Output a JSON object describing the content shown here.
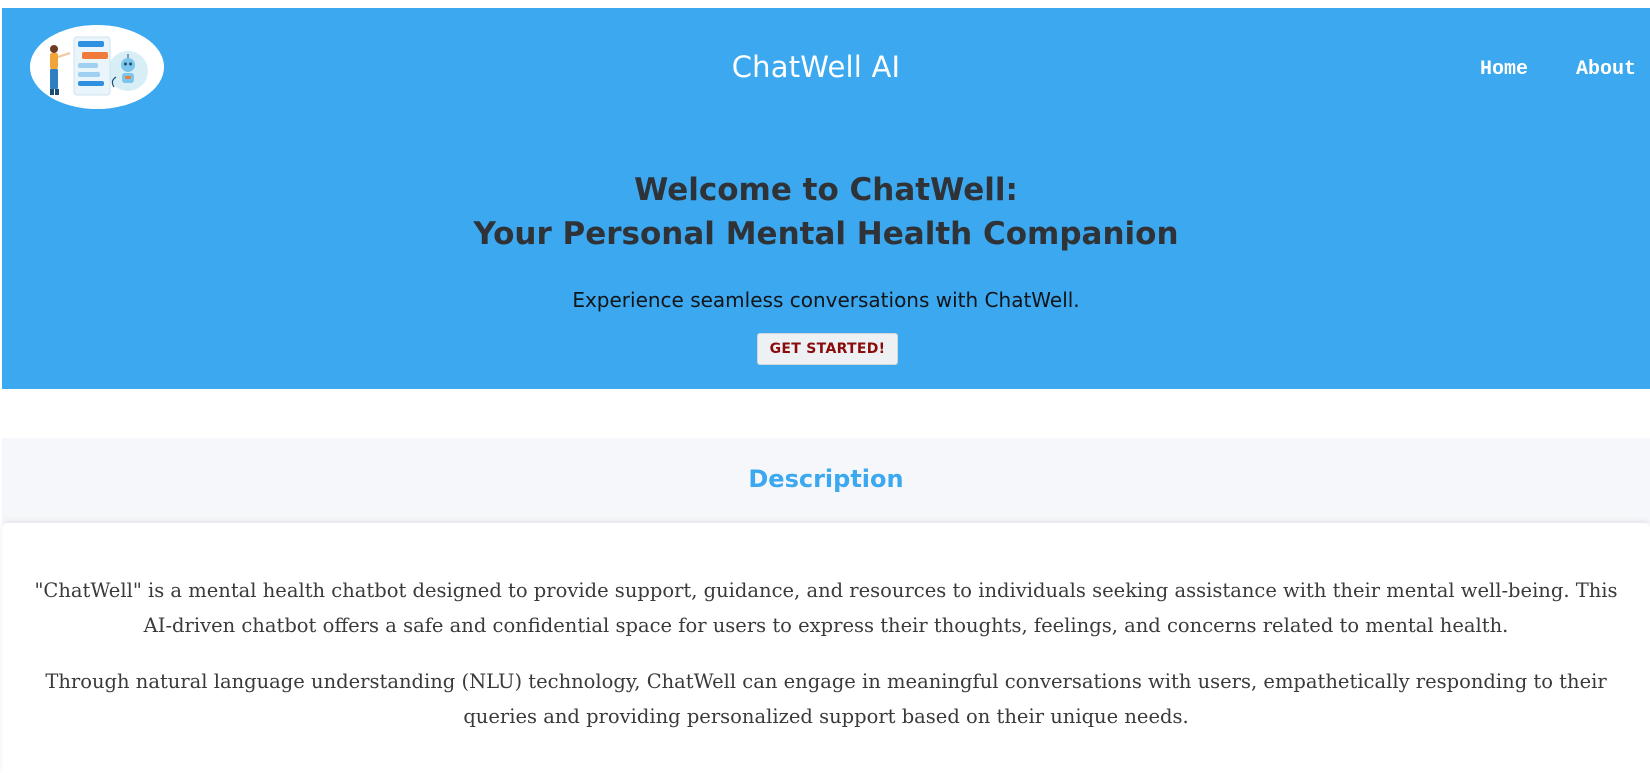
{
  "header": {
    "brand": "ChatWell AI",
    "nav": {
      "home": "Home",
      "about": "About"
    },
    "logo_icon": "chatbot-illustration"
  },
  "hero": {
    "title_line1": "Welcome to ChatWell:",
    "title_line2": "Your Personal Mental Health Companion",
    "subtitle": "Experience seamless conversations with ChatWell.",
    "cta_label": "GET STARTED!"
  },
  "description": {
    "heading": "Description",
    "paragraph1": "\"ChatWell\" is a mental health chatbot designed to provide support, guidance, and resources to individuals seeking assistance with their mental well-being. This AI-driven chatbot offers a safe and confidential space for users to express their thoughts, feelings, and concerns related to mental health.",
    "paragraph2": "Through natural language understanding (NLU) technology, ChatWell can engage in meaningful conversations with users, empathetically responding to their queries and providing personalized support based on their unique needs."
  },
  "colors": {
    "hero_bg": "#3ba8f0",
    "heading_accent": "#3ba8f0",
    "cta_text": "#8a0b0b",
    "band_bg": "#f5f7fa"
  }
}
